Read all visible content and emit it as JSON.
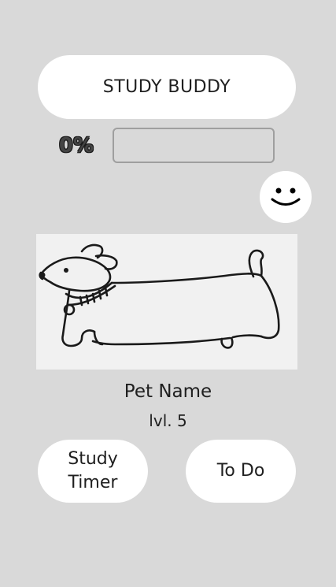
{
  "header": {
    "title": "STUDY BUDDY"
  },
  "progress": {
    "label": "0%",
    "value": 0
  },
  "mood": {
    "icon": "smiley-face-icon"
  },
  "pet": {
    "image_icon": "dachshund-dog-drawing",
    "name": "Pet Name",
    "level": "lvl. 5"
  },
  "nav": {
    "study_timer_label": "Study\nTimer",
    "todo_label": "To Do"
  },
  "colors": {
    "background": "#d9d9d9",
    "surface": "#ffffff",
    "text": "#1f1f1f"
  }
}
